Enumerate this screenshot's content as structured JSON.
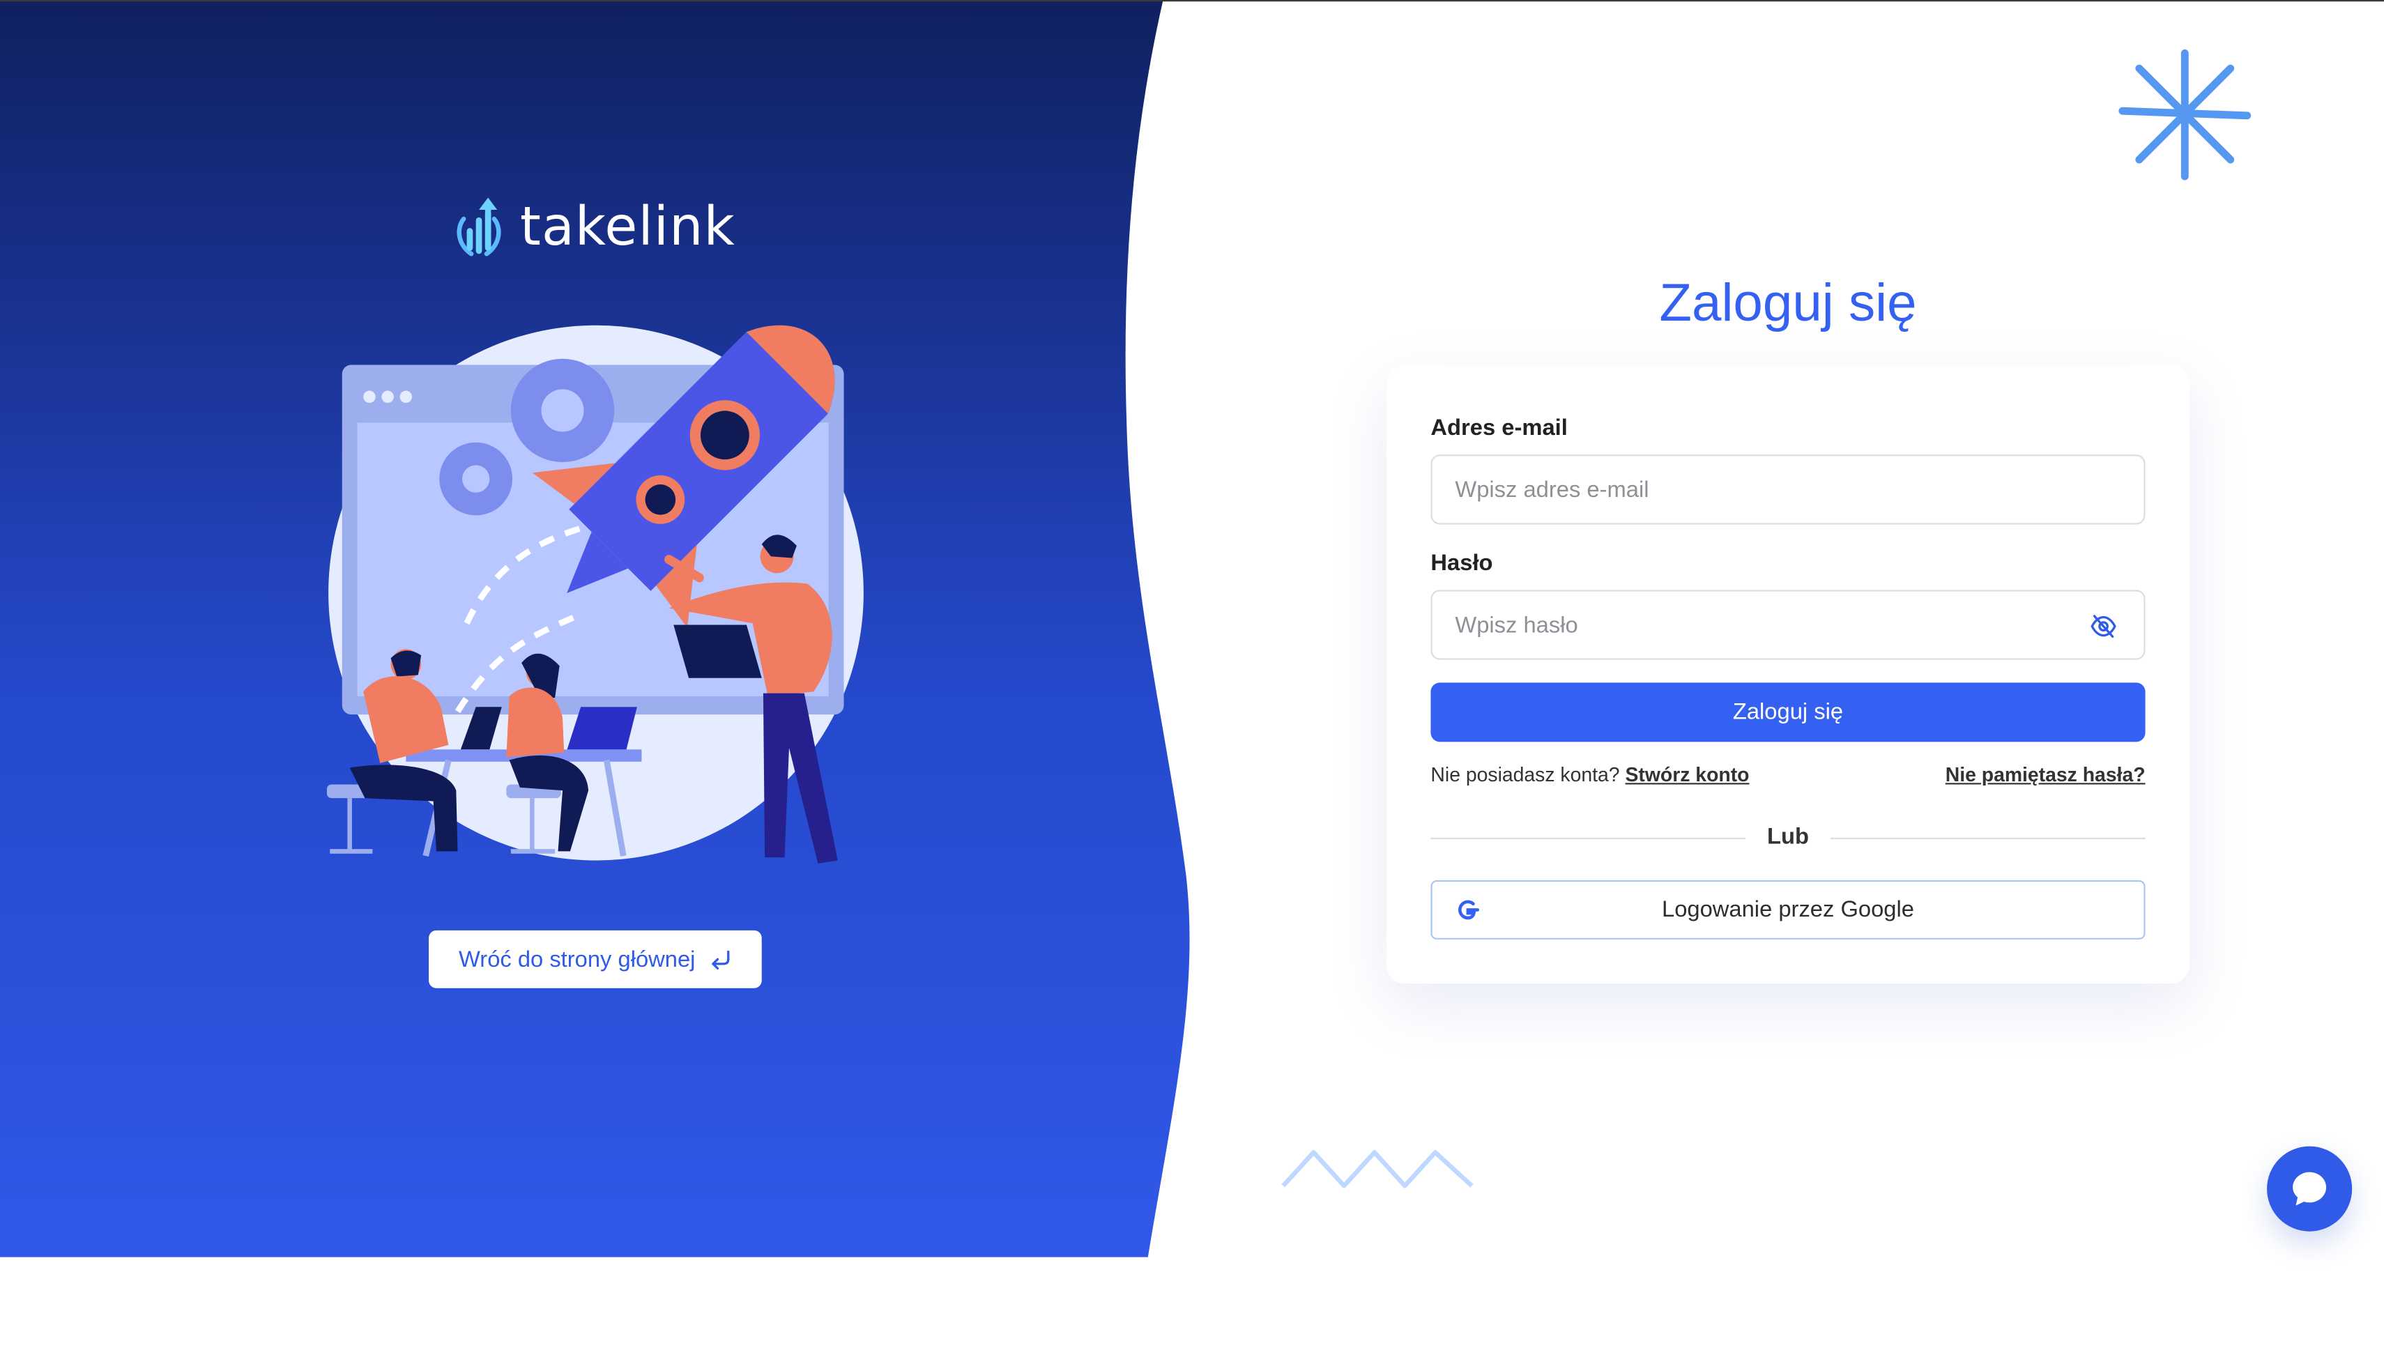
{
  "brand": {
    "name": "takelink"
  },
  "left": {
    "back_label": "Wróć do strony głównej"
  },
  "login": {
    "title": "Zaloguj się",
    "email_label": "Adres e-mail",
    "email_placeholder": "Wpisz adres e-mail",
    "password_label": "Hasło",
    "password_placeholder": "Wpisz hasło",
    "submit_label": "Zaloguj się",
    "no_account_text": "Nie posiadasz konta?",
    "create_account_label": "Stwórz konto",
    "forgot_password_label": "Nie pamiętasz hasła?",
    "or_label": "Lub",
    "google_label": "Logowanie przez Google"
  },
  "icons": {
    "logo": "bar-chart-arrow-icon",
    "back": "return-arrow-icon",
    "password_visibility": "eye-off-icon",
    "google": "google-g-icon",
    "chat": "chat-bubble-icon",
    "decoration_top": "asterisk-decoration-icon",
    "decoration_bottom": "zigzag-decoration-icon"
  },
  "colors": {
    "accent": "#3561f3",
    "left_gradient_top": "#102060",
    "left_gradient_bottom": "#3158e8",
    "illustration_orange": "#f07d61"
  }
}
